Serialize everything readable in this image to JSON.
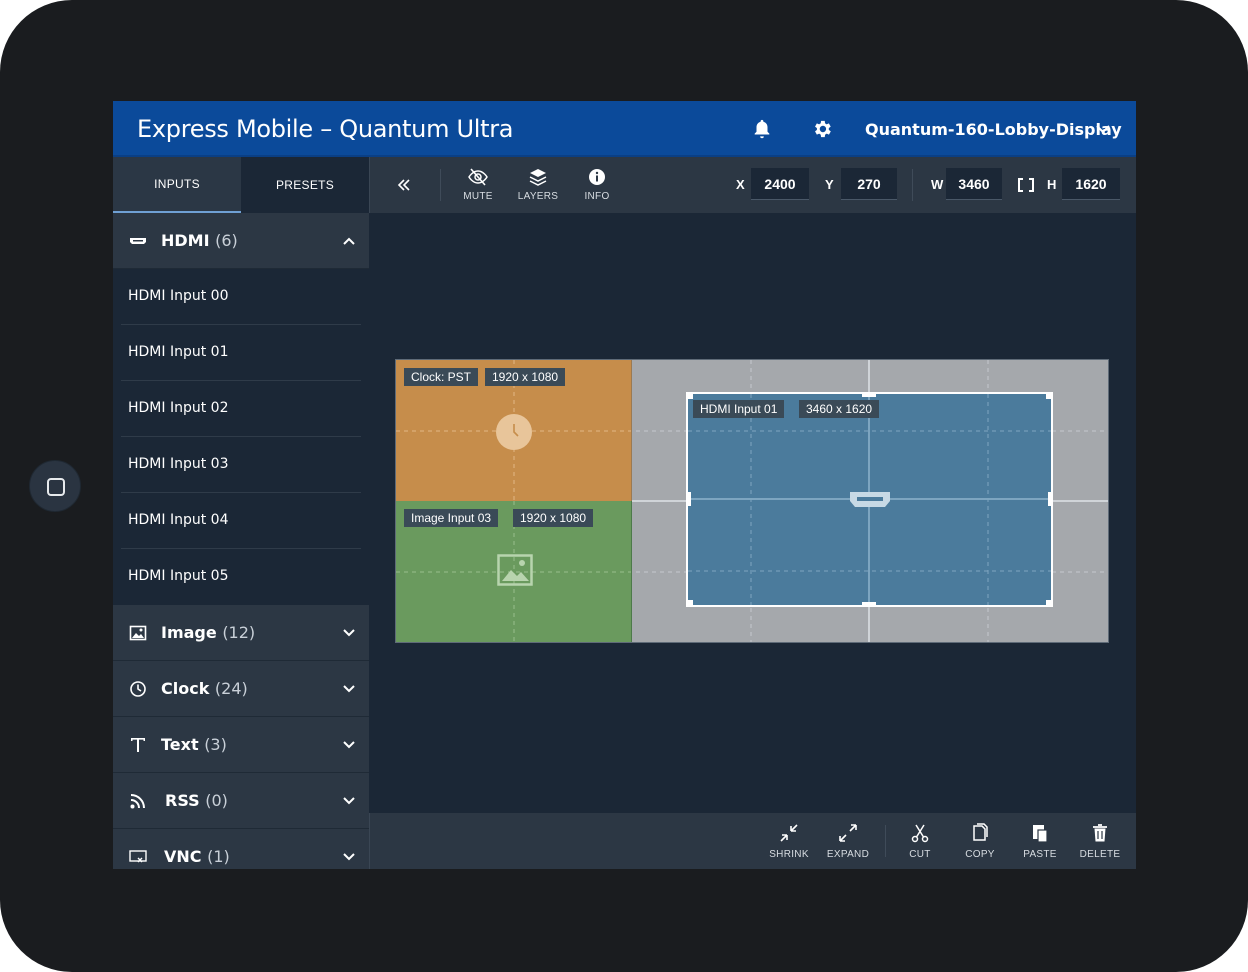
{
  "app": {
    "title": "Express Mobile – Quantum Ultra",
    "device": "Quantum-160-Lobby-Display"
  },
  "header": {
    "icons": [
      "bell-icon",
      "gear-icon",
      "chevron-down-icon"
    ]
  },
  "sidebar": {
    "tabs": [
      {
        "label": "INPUTS",
        "active": true
      },
      {
        "label": "PRESETS",
        "active": false
      }
    ],
    "hdmi": {
      "label": "HDMI",
      "count": "(6)",
      "expanded": true,
      "items": [
        "HDMI Input 00",
        "HDMI Input 01",
        "HDMI Input 02",
        "HDMI Input 03",
        "HDMI Input 04",
        "HDMI Input 05"
      ]
    },
    "categories": [
      {
        "label": "Image",
        "count": "(12)",
        "icon": "image-icon"
      },
      {
        "label": "Clock",
        "count": "(24)",
        "icon": "clock-icon"
      },
      {
        "label": "Text",
        "count": "(3)",
        "icon": "text-icon"
      },
      {
        "label": "RSS",
        "count": "(0)",
        "icon": "rss-icon"
      },
      {
        "label": "VNC",
        "count": "(1)",
        "icon": "vnc-icon"
      }
    ]
  },
  "toolbar": {
    "buttons": [
      {
        "label": "MUTE"
      },
      {
        "label": "LAYERS"
      },
      {
        "label": "INFO"
      }
    ],
    "x_label": "X",
    "x_value": "2400",
    "y_label": "Y",
    "y_value": "270",
    "w_label": "W",
    "w_value": "3460",
    "h_label": "H",
    "h_value": "1620"
  },
  "canvas": {
    "windows": [
      {
        "name": "Clock: PST",
        "size": "1920 x 1080",
        "color": "#c68d4b"
      },
      {
        "name": "Image Input 03",
        "size": "1920 x 1080",
        "color": "#6a9a5e"
      },
      {
        "name": "HDMI Input 01",
        "size": "3460 x 1620",
        "color": "#4b7b9c"
      }
    ]
  },
  "bottombar": {
    "buttons": [
      {
        "label": "SHRINK"
      },
      {
        "label": "EXPAND"
      },
      {
        "label": "CUT"
      },
      {
        "label": "COPY"
      },
      {
        "label": "PASTE"
      },
      {
        "label": "DELETE"
      }
    ]
  },
  "colors": {
    "header": "#0b4a9a",
    "panel": "#2c3744",
    "background": "#1b2736",
    "accent": "#6fa0d4"
  }
}
